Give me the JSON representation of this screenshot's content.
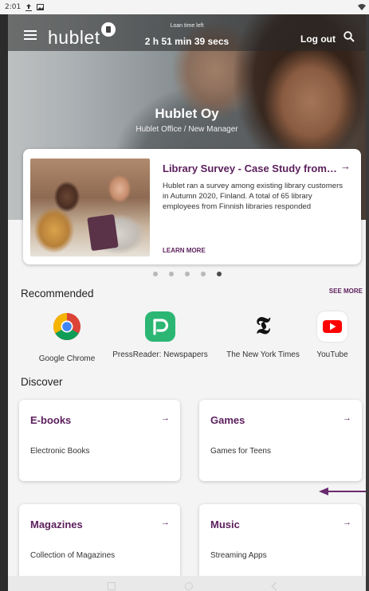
{
  "status_bar": {
    "time": "2:01",
    "icons_left": [
      "upload-icon",
      "image-icon"
    ],
    "icons_right": [
      "wifi-icon"
    ]
  },
  "header": {
    "logo_text": "hublet",
    "loan_caption": "Loan time left",
    "loan_time": "2 h 51 min 39 secs",
    "logout_label": "Log out",
    "search_icon": "search-icon",
    "menu_icon": "hamburger-menu-icon"
  },
  "hero": {
    "title": "Hublet Oy",
    "subtitle": "Hublet Office / New Manager"
  },
  "featured": {
    "title": "Library Survey - Case Study from Finland",
    "description": "Hublet ran a survey among existing library customers in Autumn 2020, Finland. A total of 65 library employees from Finnish libraries responded",
    "cta": "LEARN MORE",
    "carousel": {
      "count": 5,
      "active_index": 4
    }
  },
  "recommended": {
    "title": "Recommended",
    "see_more": "SEE MORE",
    "apps": [
      {
        "name": "Google Chrome",
        "icon": "chrome-icon"
      },
      {
        "name": "PressReader: Newspapers",
        "icon": "pressreader-icon"
      },
      {
        "name": "The New York Times",
        "icon": "nyt-icon"
      },
      {
        "name": "YouTube",
        "icon": "youtube-icon"
      }
    ]
  },
  "discover": {
    "title": "Discover",
    "tiles": [
      {
        "title": "E-books",
        "subtitle": "Electronic Books"
      },
      {
        "title": "Games",
        "subtitle": "Games for Teens"
      },
      {
        "title": "Magazines",
        "subtitle": "Collection of Magazines"
      },
      {
        "title": "Music",
        "subtitle": "Streaming Apps"
      }
    ]
  },
  "colors": {
    "brand_purple": "#5b1f5c",
    "swipe_arrow": "#6a2a6e",
    "pressreader_green": "#2bb673",
    "youtube_red": "#ff0000"
  }
}
